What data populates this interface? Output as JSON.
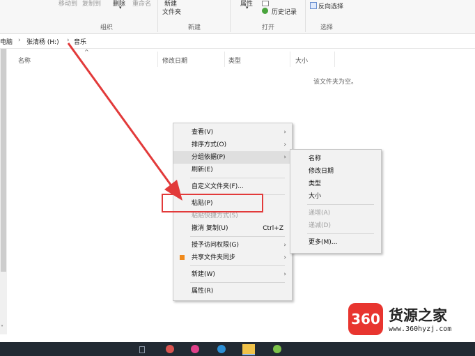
{
  "ribbon": {
    "top_labels": [
      "移动到",
      "复制到",
      "删除",
      "重命名"
    ],
    "new_folder_top": "新建",
    "new_folder_bottom": "文件夹",
    "properties": "属性",
    "history": "历史记录",
    "invert_selection": "反向选择",
    "groups": {
      "organize": "组织",
      "new": "新建",
      "open": "打开",
      "select": "选择"
    }
  },
  "address": {
    "items": [
      "电脑",
      "张清杨 (H:)",
      "音乐"
    ],
    "separator": "›"
  },
  "columns": {
    "name": "名称",
    "date": "修改日期",
    "type": "类型",
    "size": "大小"
  },
  "empty_message": "该文件夹为空。",
  "context_menu": {
    "items": [
      {
        "label": "查看(V)",
        "submenu": true
      },
      {
        "label": "排序方式(O)",
        "submenu": true
      },
      {
        "label": "分组依据(P)",
        "submenu": true
      },
      {
        "label": "刷新(E)"
      },
      {
        "label": "自定义文件夹(F)..."
      },
      {
        "label": "粘贴(P)"
      },
      {
        "label": "粘贴快捷方式(S)",
        "disabled": true
      },
      {
        "label": "撤消 复制(U)",
        "shortcut": "Ctrl+Z"
      },
      {
        "label": "授予访问权限(G)",
        "submenu": true
      },
      {
        "label": "共享文件夹同步",
        "submenu": true
      },
      {
        "label": "新建(W)",
        "submenu": true
      },
      {
        "label": "属性(R)"
      }
    ],
    "arrow": "›"
  },
  "submenu": {
    "items": [
      {
        "label": "名称"
      },
      {
        "label": "修改日期"
      },
      {
        "label": "类型"
      },
      {
        "label": "大小"
      },
      {
        "label": "递增(A)",
        "disabled": true
      },
      {
        "label": "递减(D)",
        "disabled": true
      },
      {
        "label": "更多(M)..."
      }
    ]
  },
  "watermark": {
    "badge": "360",
    "name": "货源之家",
    "url": "www.360hyzj.com"
  },
  "colors": {
    "annotation_red": "#e23a3a",
    "menu_bg": "#f2f2f2",
    "logo_red": "#e8352f",
    "taskbar": "#222a33"
  }
}
